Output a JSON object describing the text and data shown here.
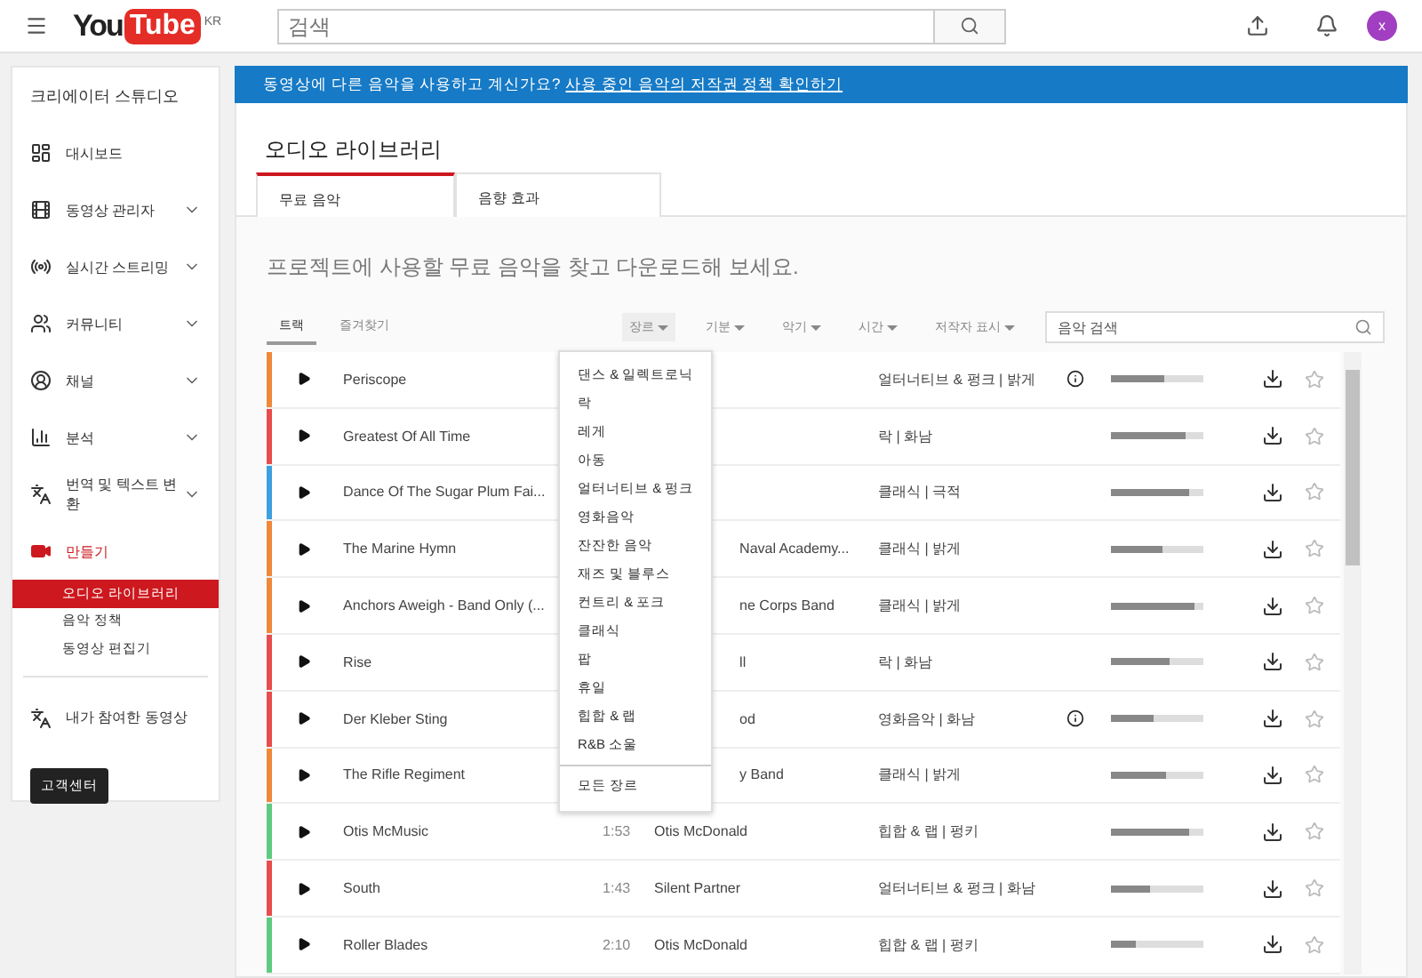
{
  "topbar": {
    "logo_you": "You",
    "logo_tube": "Tube",
    "logo_region": "KR",
    "search": {
      "placeholder": "검색"
    },
    "avatar": "x"
  },
  "sidebar": {
    "title": "크리에이터 스튜디오",
    "items": [
      {
        "kind": "dashboard",
        "label": "대시보드",
        "expandable": false,
        "active": false
      },
      {
        "kind": "videos",
        "label": "동영상 관리자",
        "expandable": true,
        "active": false
      },
      {
        "kind": "live",
        "label": "실시간 스트리밍",
        "expandable": true,
        "active": false
      },
      {
        "kind": "community",
        "label": "커뮤니티",
        "expandable": true,
        "active": false
      },
      {
        "kind": "channel",
        "label": "채널",
        "expandable": true,
        "active": false
      },
      {
        "kind": "analytics",
        "label": "분석",
        "expandable": true,
        "active": false
      },
      {
        "kind": "translate",
        "label": "번역 및 텍스트 변환",
        "expandable": true,
        "active": false
      },
      {
        "kind": "create",
        "label": "만들기",
        "expandable": false,
        "active": true,
        "children": [
          {
            "label": "오디오 라이브러리",
            "selected": true
          },
          {
            "label": "음악 정책",
            "selected": false
          },
          {
            "label": "동영상 편집기",
            "selected": false
          }
        ]
      }
    ],
    "contributions": {
      "label": "내가 참여한 동영상"
    },
    "help_button": "고객센터"
  },
  "banner": {
    "text": "동영상에 다른 음악을 사용하고 계신가요?",
    "link": "사용 중인 음악의 저작권 정책 확인하기"
  },
  "page_title": "오디오 라이브러리",
  "tabs": [
    {
      "label": "무료 음악",
      "selected": true
    },
    {
      "label": "음향 효과",
      "selected": false
    }
  ],
  "description": "프로젝트에 사용할 무료 음악을 찾고 다운로드해 보세요.",
  "view_tabs": [
    {
      "label": "트랙",
      "selected": true
    },
    {
      "label": "즐겨찾기",
      "selected": false
    }
  ],
  "filters": [
    {
      "label": "장르",
      "open": true
    },
    {
      "label": "기분",
      "open": false
    },
    {
      "label": "악기",
      "open": false
    },
    {
      "label": "시간",
      "open": false
    },
    {
      "label": "저작자 표시",
      "open": false
    }
  ],
  "music_search": {
    "placeholder": "음악 검색"
  },
  "genre_menu": {
    "items": [
      "댄스 & 일렉트로닉",
      "락",
      "레게",
      "아동",
      "얼터너티브 & 펑크",
      "영화음악",
      "잔잔한 음악",
      "재즈 및 블루스",
      "컨트리 & 포크",
      "클래식",
      "팝",
      "휴일",
      "힙합 & 랩",
      "R&B 소울"
    ],
    "all": "모든 장르"
  },
  "tracks": [
    {
      "title": "Periscope",
      "genre": "얼터너티브 & 펑크 | 밝게",
      "attribution": true,
      "level": 0.57,
      "color": "#f0883a"
    },
    {
      "title": "Greatest Of All Time",
      "genre": "락 | 화남",
      "attribution": false,
      "level": 0.8,
      "color": "#e84c4c"
    },
    {
      "title": "Dance Of The Sugar Plum Fai...",
      "genre": "클래식 | 극적",
      "attribution": false,
      "level": 0.84,
      "color": "#3ca0e0"
    },
    {
      "title": "The Marine Hymn",
      "artist": "Naval Academy...",
      "genre": "클래식 | 밝게",
      "attribution": false,
      "level": 0.55,
      "color": "#f0883a"
    },
    {
      "title": "Anchors Aweigh - Band Only (...",
      "artist": "ne Corps Band",
      "genre": "클래식 | 밝게",
      "attribution": false,
      "level": 0.9,
      "color": "#f0883a"
    },
    {
      "title": "Rise",
      "artist": "ll",
      "genre": "락 | 화남",
      "attribution": false,
      "level": 0.64,
      "color": "#e84c4c"
    },
    {
      "title": "Der Kleber Sting",
      "artist": "od",
      "genre": "영화음악 | 화남",
      "attribution": true,
      "level": 0.47,
      "color": "#e84c4c"
    },
    {
      "title": "The Rifle Regiment",
      "artist": "y Band",
      "genre": "클래식 | 밝게",
      "attribution": false,
      "level": 0.6,
      "color": "#f0883a"
    },
    {
      "title": "Otis McMusic",
      "duration": "1:53",
      "artist": "Otis McDonald",
      "genre": "힙합 & 랩 | 펑키",
      "attribution": false,
      "level": 0.85,
      "color": "#5ecb7f"
    },
    {
      "title": "South",
      "duration": "1:43",
      "artist": "Silent Partner",
      "genre": "얼터너티브 & 펑크 | 화남",
      "attribution": false,
      "level": 0.42,
      "color": "#e84c4c"
    },
    {
      "title": "Roller Blades",
      "duration": "2:10",
      "artist": "Otis McDonald",
      "genre": "힙합 & 랩 | 펑키",
      "attribution": false,
      "level": 0.26,
      "color": "#5ecb7f"
    }
  ]
}
